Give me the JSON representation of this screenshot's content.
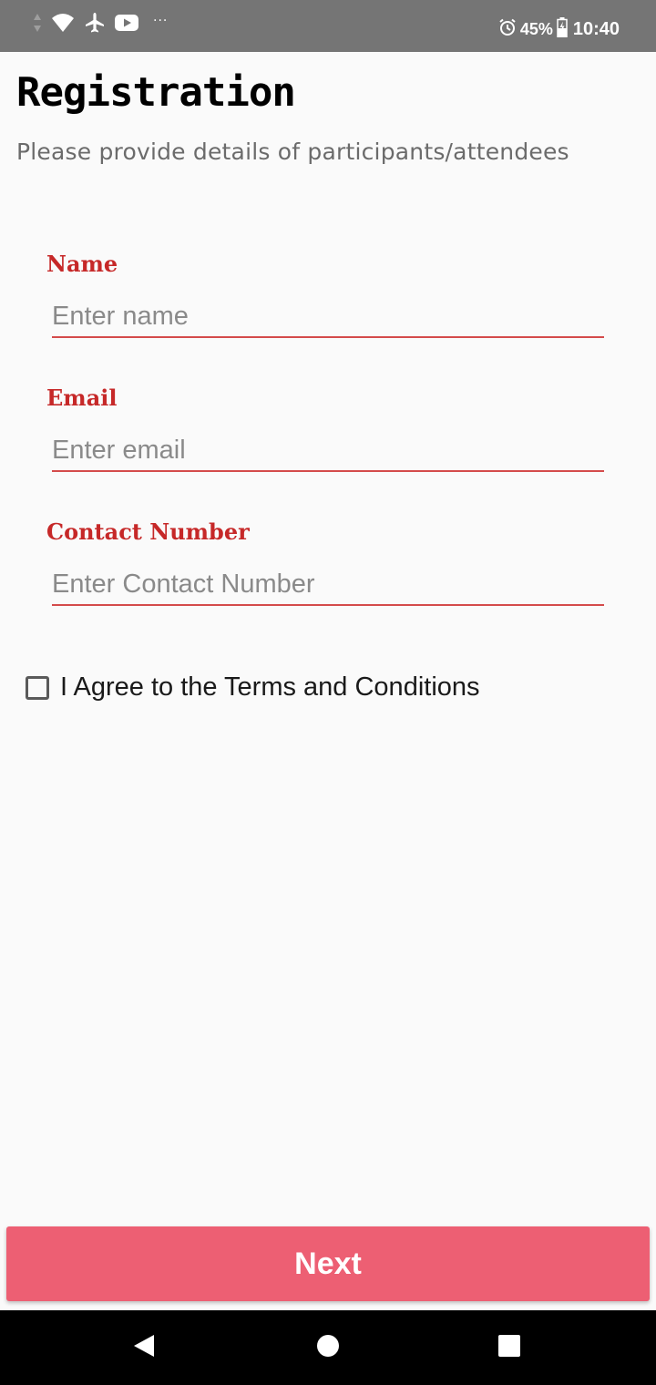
{
  "status_bar": {
    "battery": "45%",
    "time": "10:40",
    "overflow": "···",
    "icons": [
      "data-arrows-icon",
      "wifi-icon",
      "airplane-icon",
      "youtube-icon",
      "alarm-icon",
      "battery-icon"
    ]
  },
  "header": {
    "title": "Registration",
    "subtitle": "Please provide details of participants/attendees"
  },
  "form": {
    "name": {
      "label": "Name",
      "placeholder": "Enter name",
      "value": ""
    },
    "email": {
      "label": "Email",
      "placeholder": "Enter email",
      "value": ""
    },
    "contact": {
      "label": "Contact Number",
      "placeholder": "Enter Contact Number",
      "value": ""
    },
    "agree": {
      "label": "I Agree to the Terms and Conditions",
      "checked": false
    }
  },
  "actions": {
    "next_label": "Next"
  },
  "nav": {
    "icons": [
      "back-icon",
      "home-icon",
      "recents-icon"
    ]
  },
  "colors": {
    "accent": "#c62828",
    "button": "#ed5f73",
    "status_bar": "#757575",
    "background": "#fafafa"
  }
}
